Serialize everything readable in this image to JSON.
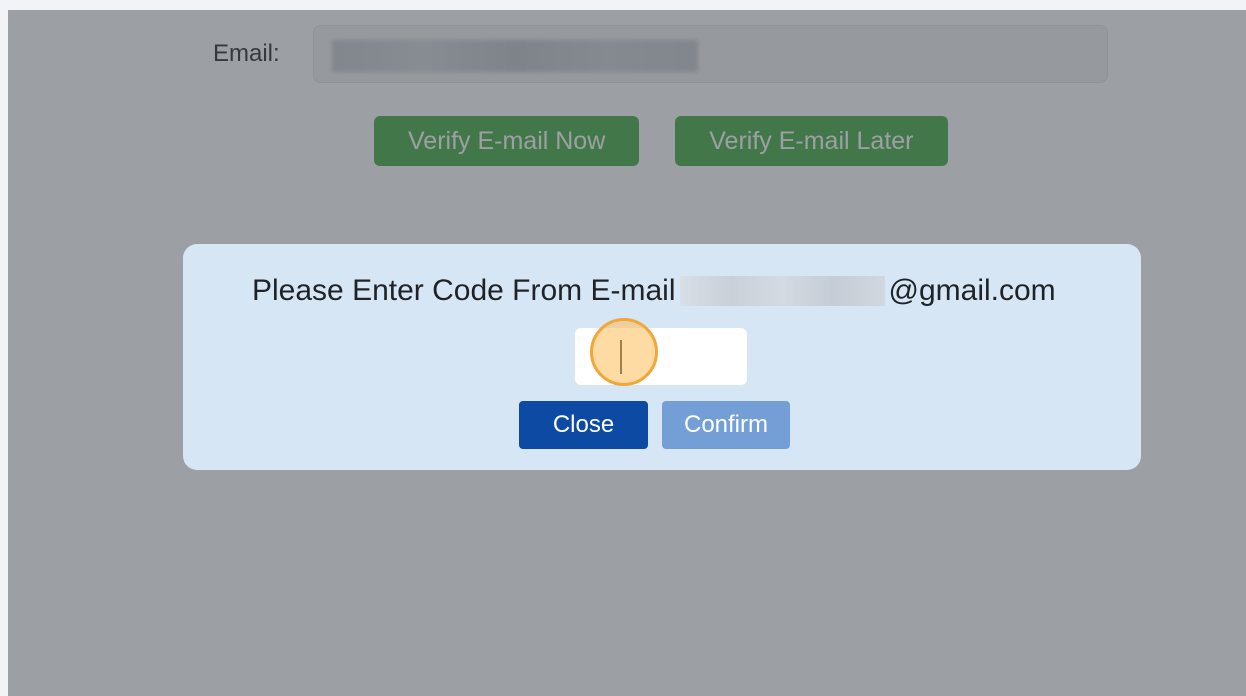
{
  "form": {
    "email_label": "Email:",
    "email_value": "",
    "verify_now_label": "Verify E-mail Now",
    "verify_later_label": "Verify E-mail Later"
  },
  "modal": {
    "prompt_prefix": "Please Enter Code From E-mail",
    "prompt_suffix": "@gmail.com",
    "code_value": "",
    "close_label": "Close",
    "confirm_label": "Confirm"
  },
  "colors": {
    "verify_button": "#5cb85c",
    "modal_background": "#d7e6f4",
    "close_button": "#0d4aa3",
    "confirm_button": "#739fd6",
    "cursor_highlight": "#f2a63a"
  }
}
